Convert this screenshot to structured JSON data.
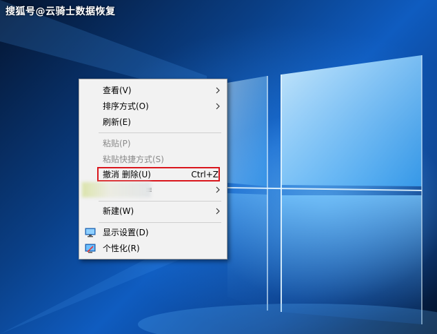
{
  "watermark": "搜狐号@云骑士数据恢复",
  "menu": {
    "view": "查看(V)",
    "sort_by": "排序方式(O)",
    "refresh": "刷新(E)",
    "paste": "粘贴(P)",
    "paste_shortcut": "粘贴快捷方式(S)",
    "undo_delete": "撤消 删除(U)",
    "undo_shortcut": "Ctrl+Z",
    "obscured_item_tail": "≡",
    "new": "新建(W)",
    "display_settings": "显示设置(D)",
    "personalize": "个性化(R)"
  },
  "icons": {
    "submenu_arrow": "chevron-right-icon",
    "display_settings": "monitor-icon",
    "personalize": "personalize-icon"
  },
  "colors": {
    "menu_bg": "#f2f2f2",
    "highlight_border": "#d9141b",
    "disabled_text": "#8a8a8a"
  }
}
